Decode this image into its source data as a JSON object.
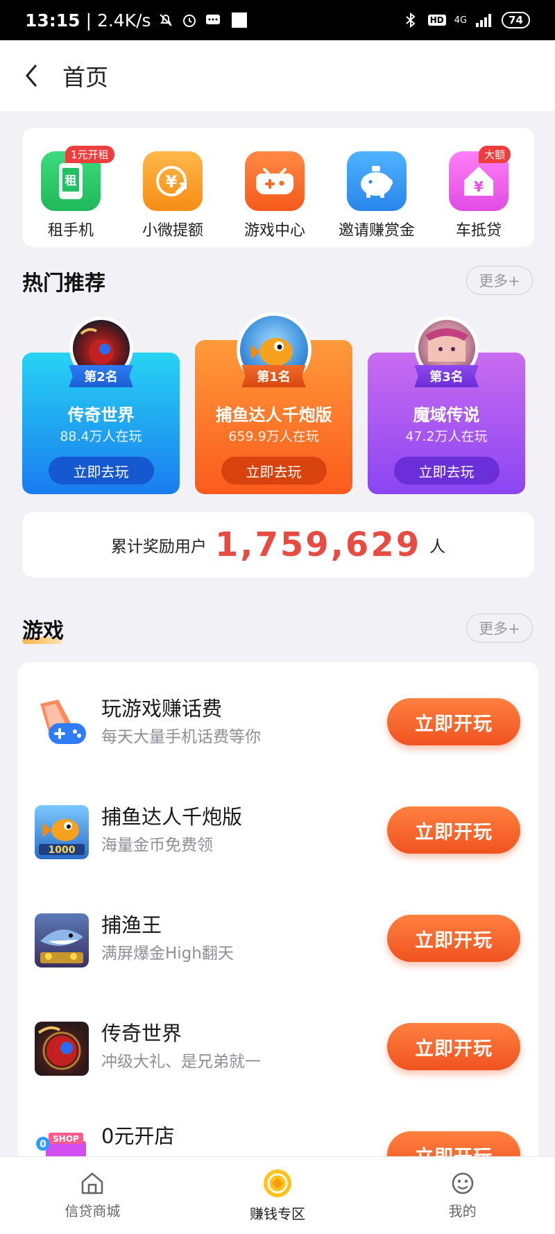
{
  "status_bar": {
    "time": "13:15",
    "speed": "| 2.4K/s",
    "network": "4G",
    "hd": "HD",
    "battery": "74"
  },
  "nav": {
    "title": "首页"
  },
  "quick_actions": [
    {
      "label": "租手机",
      "icon": "phone-rent-icon",
      "icon_glyph": "租",
      "color": "#27c86a",
      "badge": "1元开租"
    },
    {
      "label": "小微提额",
      "icon": "coin-up-icon",
      "icon_glyph": "¥",
      "color": "#fca22c",
      "badge": ""
    },
    {
      "label": "游戏中心",
      "icon": "gamepad-icon",
      "icon_glyph": "✚",
      "color": "#fb6a28",
      "badge": ""
    },
    {
      "label": "邀请赚赏金",
      "icon": "piggy-bank-icon",
      "icon_glyph": "●",
      "color": "#3d9cf5",
      "badge": ""
    },
    {
      "label": "车抵贷",
      "icon": "house-yen-icon",
      "icon_glyph": "¥",
      "color": "#ee5cf0",
      "badge": "大额"
    }
  ],
  "hot": {
    "title": "热门推荐",
    "more": "更多+",
    "items": [
      {
        "rank": "第2名",
        "name": "传奇世界",
        "players": "88.4万人在玩",
        "button": "立即去玩"
      },
      {
        "rank": "第1名",
        "name": "捕鱼达人千炮版",
        "players": "659.9万人在玩",
        "button": "立即去玩"
      },
      {
        "rank": "第3名",
        "name": "魔域传说",
        "players": "47.2万人在玩",
        "button": "立即去玩"
      }
    ]
  },
  "reward": {
    "prefix": "累计奖励用户",
    "count": "1,759,629",
    "suffix": "人"
  },
  "games": {
    "title": "游戏",
    "more": "更多+",
    "items": [
      {
        "title": "玩游戏赚话费",
        "subtitle": "每天大量手机话费等你",
        "button": "立即开玩"
      },
      {
        "title": "捕鱼达人千炮版",
        "subtitle": "海量金币免费领",
        "button": "立即开玩"
      },
      {
        "title": "捕渔王",
        "subtitle": "满屏爆金High翻天",
        "button": "立即开玩"
      },
      {
        "title": "传奇世界",
        "subtitle": "冲级大礼、是兄弟就一",
        "button": "立即开玩"
      },
      {
        "title": "0元开店",
        "subtitle": "",
        "button": "立即开玩"
      }
    ]
  },
  "tabs": [
    {
      "label": "信贷商城",
      "icon": "home-icon",
      "active": false
    },
    {
      "label": "赚钱专区",
      "icon": "coin-icon",
      "active": true
    },
    {
      "label": "我的",
      "icon": "smile-face-icon",
      "active": false
    }
  ]
}
